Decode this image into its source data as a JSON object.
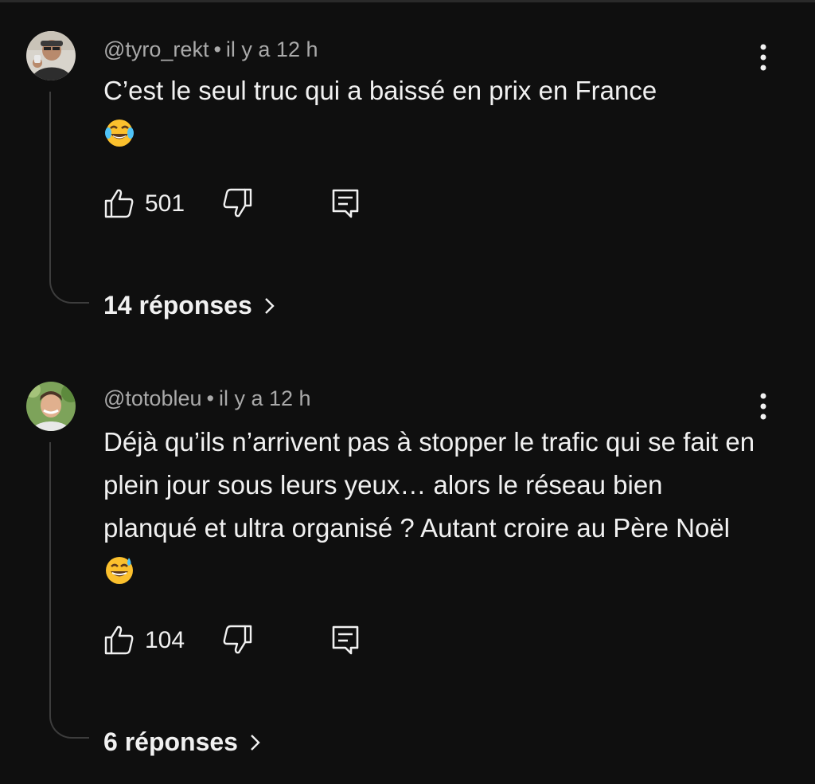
{
  "comments": [
    {
      "author": "@tyro_rekt",
      "separator": "•",
      "time": "il y a 12 h",
      "text": "C’est le seul truc qui a baissé en prix en France",
      "emoji_icon": "face-with-tears-of-joy-icon",
      "likes": "501",
      "replies": "14 réponses"
    },
    {
      "author": "@totobleu",
      "separator": "•",
      "time": "il y a 12 h",
      "text": "Déjà qu’ils n’arrivent pas à stopper le trafic qui se fait en plein jour sous leurs yeux… alors le réseau bien planqué et ultra organisé ? Autant croire au Père Noël",
      "emoji_icon": "grinning-face-with-sweat-icon",
      "likes": "104",
      "replies": "6 réponses"
    }
  ],
  "colors": {
    "background": "#0f0f0f",
    "text": "#f1f1f1",
    "meta": "#aaaaaa",
    "thread_line": "#3d3d3d"
  }
}
